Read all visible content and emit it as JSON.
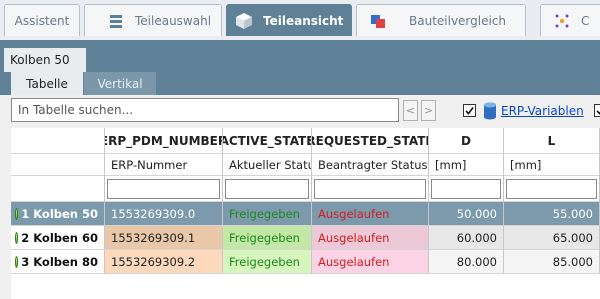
{
  "top_tabs": [
    {
      "label": "Assistent",
      "icon": "none"
    },
    {
      "label": "Teileauswahl",
      "icon": "stack-icon"
    },
    {
      "label": "Teileansicht",
      "icon": "cube-icon"
    },
    {
      "label": "Bauteilvergleich",
      "icon": "compare-icon"
    },
    {
      "label": "C",
      "icon": "network-icon"
    }
  ],
  "active_top_tab": "Teileansicht",
  "part_tab": "Kolben 50",
  "view_tabs": [
    "Tabelle",
    "Vertikal"
  ],
  "search": {
    "placeholder": "In Tabelle suchen..."
  },
  "nav": {
    "prev": "<",
    "next": ">"
  },
  "erp_link": "ERP-Variablen",
  "columns": [
    {
      "id": "ERP_PDM_NUMBER",
      "title": "ERP_PDM_NUMBER",
      "subtitle": "ERP-Nummer"
    },
    {
      "id": "ACTIVE_STATE",
      "title": "ACTIVE_STATE",
      "subtitle": "Aktueller Status"
    },
    {
      "id": "REQUESTED_STATE",
      "title": "REQUESTED_STATE",
      "subtitle": "Beantragter Status"
    },
    {
      "id": "D",
      "title": "D",
      "subtitle": "[mm]"
    },
    {
      "id": "L",
      "title": "L",
      "subtitle": "[mm]"
    }
  ],
  "rows": [
    {
      "num": "1",
      "name": "Kolben 50",
      "erp": "1553269309.0",
      "active": "Freigegeben",
      "requested": "Ausgelaufen",
      "d": "50.000",
      "l": "55.000",
      "selected": true
    },
    {
      "num": "2",
      "name": "Kolben 60",
      "erp": "1553269309.1",
      "active": "Freigegeben",
      "requested": "Ausgelaufen",
      "d": "60.000",
      "l": "65.000",
      "selected": false
    },
    {
      "num": "3",
      "name": "Kolben 80",
      "erp": "1553269309.2",
      "active": "Freigegeben",
      "requested": "Ausgelaufen",
      "d": "80.000",
      "l": "85.000",
      "selected": false
    }
  ],
  "colors": {
    "accent": "#5f8197",
    "active_green": "#1a8a1a",
    "requested_red": "#d02020"
  }
}
